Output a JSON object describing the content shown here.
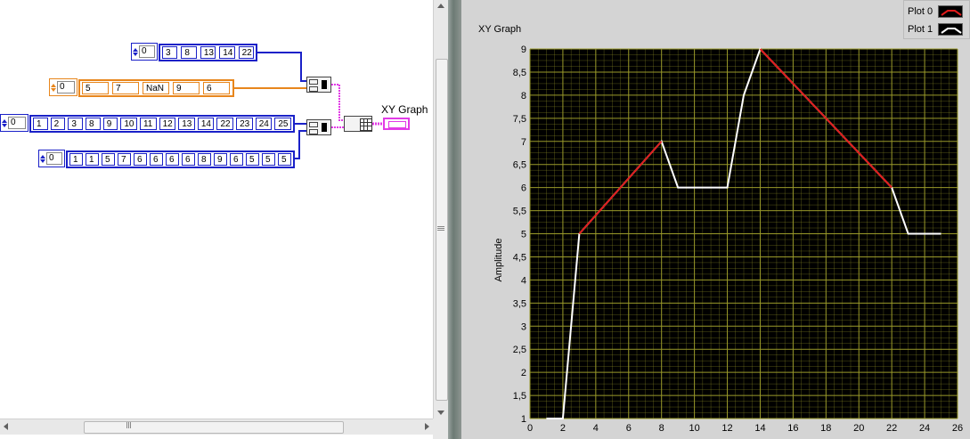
{
  "block_diagram": {
    "arrays": [
      {
        "index": "0",
        "values": [
          "3",
          "8",
          "13",
          "14",
          "22"
        ]
      },
      {
        "index": "0",
        "values": [
          "5",
          "7",
          "NaN",
          "9",
          "6"
        ]
      },
      {
        "index": "0",
        "values": [
          "1",
          "2",
          "3",
          "8",
          "9",
          "10",
          "11",
          "12",
          "13",
          "14",
          "22",
          "23",
          "24",
          "25"
        ]
      },
      {
        "index": "0",
        "values": [
          "1",
          "1",
          "5",
          "7",
          "6",
          "6",
          "6",
          "6",
          "8",
          "9",
          "6",
          "5",
          "5",
          "5"
        ]
      }
    ],
    "graph_terminal_label": "XY Graph",
    "wire_colors": {
      "numeric": "#1a21c8",
      "float": "#e8861c",
      "cluster": "#e23be6"
    }
  },
  "front_panel": {
    "graph_title": "XY Graph",
    "legend": [
      {
        "name": "Plot 0",
        "color": "#e01b1b"
      },
      {
        "name": "Plot 1",
        "color": "#ffffff"
      }
    ]
  },
  "chart_data": {
    "type": "line",
    "title": "XY Graph",
    "xlabel": "",
    "ylabel": "Amplitude",
    "xlim": [
      0,
      26
    ],
    "ylim": [
      1,
      9
    ],
    "x_ticks": [
      "0",
      "2",
      "4",
      "6",
      "8",
      "10",
      "12",
      "14",
      "16",
      "18",
      "20",
      "22",
      "24",
      "26"
    ],
    "y_ticks": [
      "1",
      "1,5",
      "2",
      "2,5",
      "3",
      "3,5",
      "4",
      "4,5",
      "5",
      "5,5",
      "6",
      "6,5",
      "7",
      "7,5",
      "8",
      "8,5",
      "9"
    ],
    "grid": true,
    "background": "#000000",
    "grid_color": "#9a9a2a",
    "legend_position": "top-right",
    "series": [
      {
        "name": "Plot 0",
        "color": "#e01b1b",
        "x": [
          3,
          8,
          13,
          14,
          22
        ],
        "y": [
          5,
          7,
          null,
          9,
          6
        ]
      },
      {
        "name": "Plot 1",
        "color": "#ffffff",
        "x": [
          1,
          2,
          3,
          8,
          9,
          10,
          11,
          12,
          13,
          14,
          22,
          23,
          24,
          25
        ],
        "y": [
          1,
          1,
          5,
          7,
          6,
          6,
          6,
          6,
          8,
          9,
          6,
          5,
          5,
          5
        ]
      }
    ]
  }
}
